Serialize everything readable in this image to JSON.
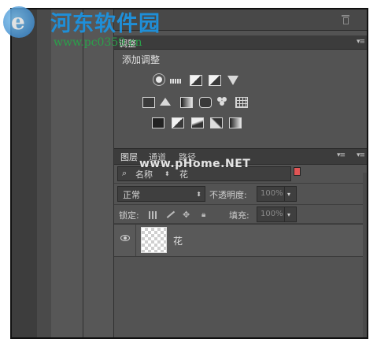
{
  "watermark": {
    "site_name": "河东软件园",
    "site_url": "www.pc0359.cn",
    "overlay_text": "www.pHome.NET"
  },
  "adjustments_panel": {
    "tab_label": "调整",
    "title": "添加调整",
    "icons": [
      "brightness-contrast-icon",
      "levels-icon",
      "curves-icon",
      "exposure-icon",
      "vibrance-icon",
      "hue-saturation-icon",
      "color-balance-icon",
      "black-white-icon",
      "photo-filter-icon",
      "channel-mixer-icon",
      "color-lookup-icon",
      "invert-icon",
      "posterize-icon",
      "threshold-icon",
      "selective-color-icon",
      "gradient-map-icon"
    ]
  },
  "layers_panel": {
    "tabs": [
      "图层",
      "通道",
      "路径"
    ],
    "active_tab": "图层",
    "filter": {
      "type_label": "名称",
      "value": "花"
    },
    "blend_mode": "正常",
    "opacity_label": "不透明度:",
    "opacity_value": "100%",
    "lock_label": "锁定:",
    "fill_label": "填充:",
    "fill_value": "100%",
    "layers": [
      {
        "name": "花",
        "visible": true
      }
    ]
  },
  "colors": {
    "filter_swatch": "#e05555",
    "panel_bg": "#535353"
  }
}
